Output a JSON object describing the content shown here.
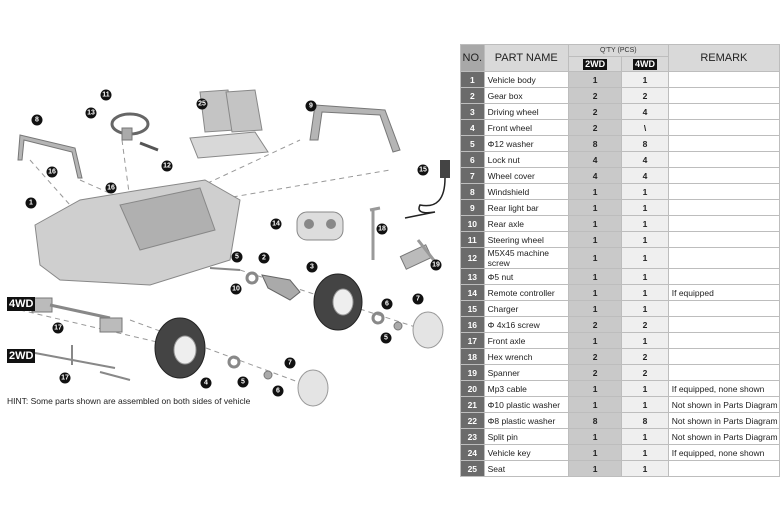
{
  "diagram": {
    "tags": {
      "four_wd": "4WD",
      "two_wd": "2WD"
    },
    "hint": "HINT: Some parts shown are assembled on both sides of vehicle",
    "callouts": [
      "1",
      "2",
      "3",
      "4",
      "5",
      "5",
      "5",
      "6",
      "6",
      "7",
      "7",
      "8",
      "9",
      "10",
      "11",
      "12",
      "13",
      "14",
      "15",
      "16",
      "16",
      "17",
      "17",
      "18",
      "19",
      "25"
    ]
  },
  "table": {
    "headers": {
      "no": "NO.",
      "part_name": "PART NAME",
      "qty": "Q'TY (PCS)",
      "two_wd": "2WD",
      "four_wd": "4WD",
      "remark": "REMARK"
    },
    "rows": [
      {
        "no": "1",
        "name": "Vehicle body",
        "q2": "1",
        "q4": "1",
        "remark": ""
      },
      {
        "no": "2",
        "name": "Gear box",
        "q2": "2",
        "q4": "2",
        "remark": ""
      },
      {
        "no": "3",
        "name": "Driving wheel",
        "q2": "2",
        "q4": "4",
        "remark": ""
      },
      {
        "no": "4",
        "name": "Front wheel",
        "q2": "2",
        "q4": "\\",
        "remark": ""
      },
      {
        "no": "5",
        "name": "Φ12 washer",
        "q2": "8",
        "q4": "8",
        "remark": ""
      },
      {
        "no": "6",
        "name": "Lock nut",
        "q2": "4",
        "q4": "4",
        "remark": ""
      },
      {
        "no": "7",
        "name": "Wheel cover",
        "q2": "4",
        "q4": "4",
        "remark": ""
      },
      {
        "no": "8",
        "name": "Windshield",
        "q2": "1",
        "q4": "1",
        "remark": ""
      },
      {
        "no": "9",
        "name": "Rear light bar",
        "q2": "1",
        "q4": "1",
        "remark": ""
      },
      {
        "no": "10",
        "name": "Rear axle",
        "q2": "1",
        "q4": "1",
        "remark": ""
      },
      {
        "no": "11",
        "name": "Steering wheel",
        "q2": "1",
        "q4": "1",
        "remark": ""
      },
      {
        "no": "12",
        "name": "M5X45 machine screw",
        "q2": "1",
        "q4": "1",
        "remark": ""
      },
      {
        "no": "13",
        "name": "Φ5 nut",
        "q2": "1",
        "q4": "1",
        "remark": ""
      },
      {
        "no": "14",
        "name": "Remote controller",
        "q2": "1",
        "q4": "1",
        "remark": "If equipped"
      },
      {
        "no": "15",
        "name": "Charger",
        "q2": "1",
        "q4": "1",
        "remark": ""
      },
      {
        "no": "16",
        "name": "Φ 4x16 screw",
        "q2": "2",
        "q4": "2",
        "remark": ""
      },
      {
        "no": "17",
        "name": "Front axle",
        "q2": "1",
        "q4": "1",
        "remark": ""
      },
      {
        "no": "18",
        "name": "Hex wrench",
        "q2": "2",
        "q4": "2",
        "remark": ""
      },
      {
        "no": "19",
        "name": "Spanner",
        "q2": "2",
        "q4": "2",
        "remark": ""
      },
      {
        "no": "20",
        "name": "Mp3 cable",
        "q2": "1",
        "q4": "1",
        "remark": "If equipped, none shown"
      },
      {
        "no": "21",
        "name": "Φ10 plastic washer",
        "q2": "1",
        "q4": "1",
        "remark": "Not shown in Parts Diagram"
      },
      {
        "no": "22",
        "name": "Φ8 plastic washer",
        "q2": "8",
        "q4": "8",
        "remark": "Not shown in Parts Diagram"
      },
      {
        "no": "23",
        "name": "Split pin",
        "q2": "1",
        "q4": "1",
        "remark": "Not shown in Parts Diagram"
      },
      {
        "no": "24",
        "name": "Vehicle key",
        "q2": "1",
        "q4": "1",
        "remark": "If equipped, none shown"
      },
      {
        "no": "25",
        "name": "Seat",
        "q2": "1",
        "q4": "1",
        "remark": ""
      }
    ]
  }
}
